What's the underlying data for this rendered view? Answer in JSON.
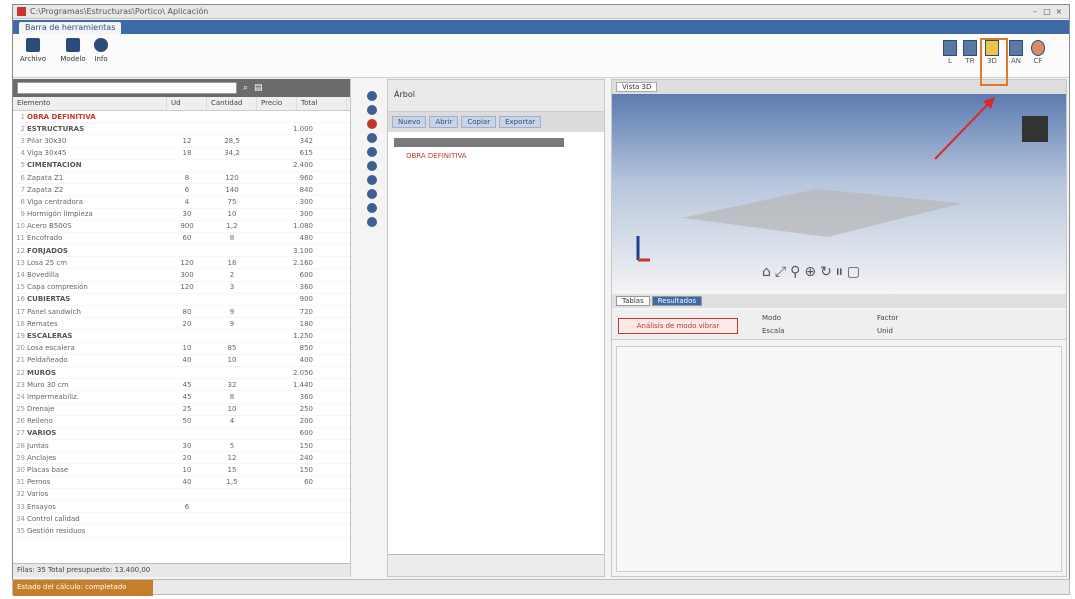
{
  "window": {
    "title": "C:\\Programas\\Estructuras\\Portico\\ Aplicación",
    "controls": [
      "–",
      "□",
      "×"
    ]
  },
  "ribbon": {
    "tab_label": "Barra de herramientas",
    "left_buttons": [
      {
        "label": "Archivo",
        "icon": "save-icon"
      },
      {
        "label": "Modelo",
        "icon": "grid-icon"
      },
      {
        "label": "Info",
        "icon": "info-icon"
      }
    ],
    "right_buttons": [
      {
        "label": "L",
        "icon": "layout-icon"
      },
      {
        "label": "TR",
        "icon": "table-icon"
      },
      {
        "label": "3D",
        "icon": "cube-icon"
      },
      {
        "label": "AN",
        "icon": "pen-icon"
      },
      {
        "label": "CF",
        "icon": "gear-icon"
      }
    ]
  },
  "left_panel": {
    "columns": [
      "Elemento",
      "Ud",
      "Cantidad",
      "Precio",
      "Total"
    ],
    "rows": [
      {
        "num": "1",
        "name": "OBRA DEFINITIVA",
        "c1": "",
        "c2": "",
        "c3": "",
        "kind": "root"
      },
      {
        "num": "2",
        "name": "ESTRUCTURAS",
        "c1": "",
        "c2": "",
        "c3": "1.000",
        "kind": "group"
      },
      {
        "num": "3",
        "name": "Pilar 30x30",
        "c1": "12",
        "c2": "28,5",
        "c3": "342",
        "kind": ""
      },
      {
        "num": "4",
        "name": "Viga 30x45",
        "c1": "18",
        "c2": "34,2",
        "c3": "615",
        "kind": ""
      },
      {
        "num": "5",
        "name": "CIMENTACIÓN",
        "c1": "",
        "c2": "",
        "c3": "2.400",
        "kind": "group"
      },
      {
        "num": "6",
        "name": "Zapata Z1",
        "c1": "8",
        "c2": "120",
        "c3": "960",
        "kind": ""
      },
      {
        "num": "7",
        "name": "Zapata Z2",
        "c1": "6",
        "c2": "140",
        "c3": "840",
        "kind": ""
      },
      {
        "num": "8",
        "name": "Viga centradora",
        "c1": "4",
        "c2": "75",
        "c3": "300",
        "kind": ""
      },
      {
        "num": "9",
        "name": "Hormigón limpieza",
        "c1": "30",
        "c2": "10",
        "c3": "300",
        "kind": ""
      },
      {
        "num": "10",
        "name": "Acero B500S",
        "c1": "900",
        "c2": "1,2",
        "c3": "1.080",
        "kind": ""
      },
      {
        "num": "11",
        "name": "Encofrado",
        "c1": "60",
        "c2": "8",
        "c3": "480",
        "kind": ""
      },
      {
        "num": "12",
        "name": "FORJADOS",
        "c1": "",
        "c2": "",
        "c3": "3.100",
        "kind": "group"
      },
      {
        "num": "13",
        "name": "Losa 25 cm",
        "c1": "120",
        "c2": "18",
        "c3": "2.160",
        "kind": ""
      },
      {
        "num": "14",
        "name": "Bovedilla",
        "c1": "300",
        "c2": "2",
        "c3": "600",
        "kind": ""
      },
      {
        "num": "15",
        "name": "Capa compresión",
        "c1": "120",
        "c2": "3",
        "c3": "360",
        "kind": ""
      },
      {
        "num": "16",
        "name": "CUBIERTAS",
        "c1": "",
        "c2": "",
        "c3": "900",
        "kind": "group"
      },
      {
        "num": "17",
        "name": "Panel sandwich",
        "c1": "80",
        "c2": "9",
        "c3": "720",
        "kind": ""
      },
      {
        "num": "18",
        "name": "Remates",
        "c1": "20",
        "c2": "9",
        "c3": "180",
        "kind": ""
      },
      {
        "num": "19",
        "name": "ESCALERAS",
        "c1": "",
        "c2": "",
        "c3": "1.250",
        "kind": "group"
      },
      {
        "num": "20",
        "name": "Losa escalera",
        "c1": "10",
        "c2": "85",
        "c3": "850",
        "kind": ""
      },
      {
        "num": "21",
        "name": "Peldañeado",
        "c1": "40",
        "c2": "10",
        "c3": "400",
        "kind": ""
      },
      {
        "num": "22",
        "name": "MUROS",
        "c1": "",
        "c2": "",
        "c3": "2.050",
        "kind": "group"
      },
      {
        "num": "23",
        "name": "Muro 30 cm",
        "c1": "45",
        "c2": "32",
        "c3": "1.440",
        "kind": ""
      },
      {
        "num": "24",
        "name": "Impermeabiliz.",
        "c1": "45",
        "c2": "8",
        "c3": "360",
        "kind": ""
      },
      {
        "num": "25",
        "name": "Drenaje",
        "c1": "25",
        "c2": "10",
        "c3": "250",
        "kind": ""
      },
      {
        "num": "26",
        "name": "Relleno",
        "c1": "50",
        "c2": "4",
        "c3": "200",
        "kind": ""
      },
      {
        "num": "27",
        "name": "VARIOS",
        "c1": "",
        "c2": "",
        "c3": "600",
        "kind": "group"
      },
      {
        "num": "28",
        "name": "Juntas",
        "c1": "30",
        "c2": "5",
        "c3": "150",
        "kind": ""
      },
      {
        "num": "29",
        "name": "Anclajes",
        "c1": "20",
        "c2": "12",
        "c3": "240",
        "kind": ""
      },
      {
        "num": "30",
        "name": "Placas base",
        "c1": "10",
        "c2": "15",
        "c3": "150",
        "kind": ""
      },
      {
        "num": "31",
        "name": "Pernos",
        "c1": "40",
        "c2": "1,5",
        "c3": "60",
        "kind": ""
      },
      {
        "num": "32",
        "name": "Varios",
        "c1": "",
        "c2": "",
        "c3": "",
        "kind": ""
      },
      {
        "num": "33",
        "name": "Ensayos",
        "c1": "6",
        "c2": "",
        "c3": "",
        "kind": ""
      },
      {
        "num": "34",
        "name": "Control calidad",
        "c1": "",
        "c2": "",
        "c3": "",
        "kind": ""
      },
      {
        "num": "35",
        "name": "Gestión residuos",
        "c1": "",
        "c2": "",
        "c3": "",
        "kind": ""
      }
    ],
    "footer": "Filas: 35   Total presupuesto: 13.400,00"
  },
  "middle_panel": {
    "header_label": "Árbol",
    "tabs": [
      "Nuevo",
      "Abrir",
      "Copiar",
      "Exportar"
    ],
    "tree_node": "OBRA DEFINITIVA"
  },
  "right_panel": {
    "viewport_tab": "Vista 3D",
    "result_tabs": [
      "Tablas",
      "Resultados"
    ],
    "analysis_button": "Análisis de modo vibrar",
    "field1_label": "Modo",
    "field2_label": "Escala",
    "field3_label": "Factor",
    "field4_label": "Unid"
  },
  "statusbar": {
    "button_label": "Estado del cálculo: completado"
  }
}
